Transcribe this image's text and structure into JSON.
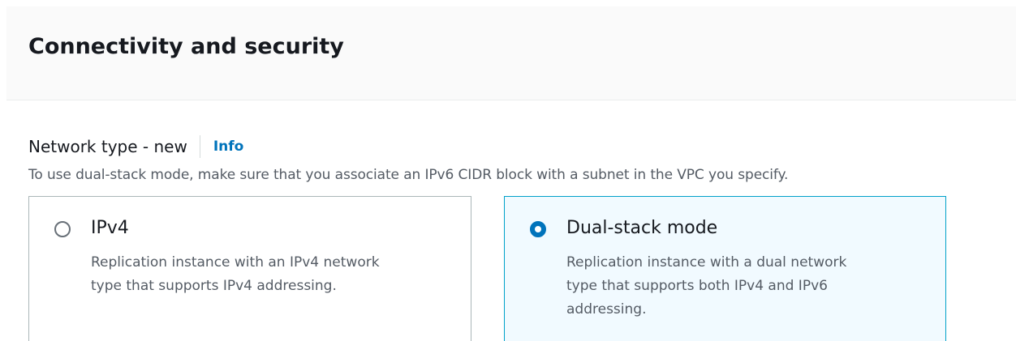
{
  "section": {
    "title": "Connectivity and security"
  },
  "network_type": {
    "label": "Network type - new",
    "info_link": "Info",
    "description": "To use dual-stack mode, make sure that you associate an IPv6 CIDR block with a subnet in the VPC you specify.",
    "selected": "Dual-stack mode",
    "options": [
      {
        "title": "IPv4",
        "description": "Replication instance with an IPv4 network type that supports IPv4 addressing.",
        "selected": false
      },
      {
        "title": "Dual-stack mode",
        "description": "Replication instance with a dual network type that supports both IPv4 and IPv6 addressing.",
        "selected": true
      }
    ]
  },
  "colors": {
    "accent": "#0073bb",
    "selected_border": "#00a1c9",
    "selected_background": "#f1faff",
    "tile_border": "#aab7b8",
    "header_background": "#fafafa",
    "secondary_text": "#545b64"
  }
}
